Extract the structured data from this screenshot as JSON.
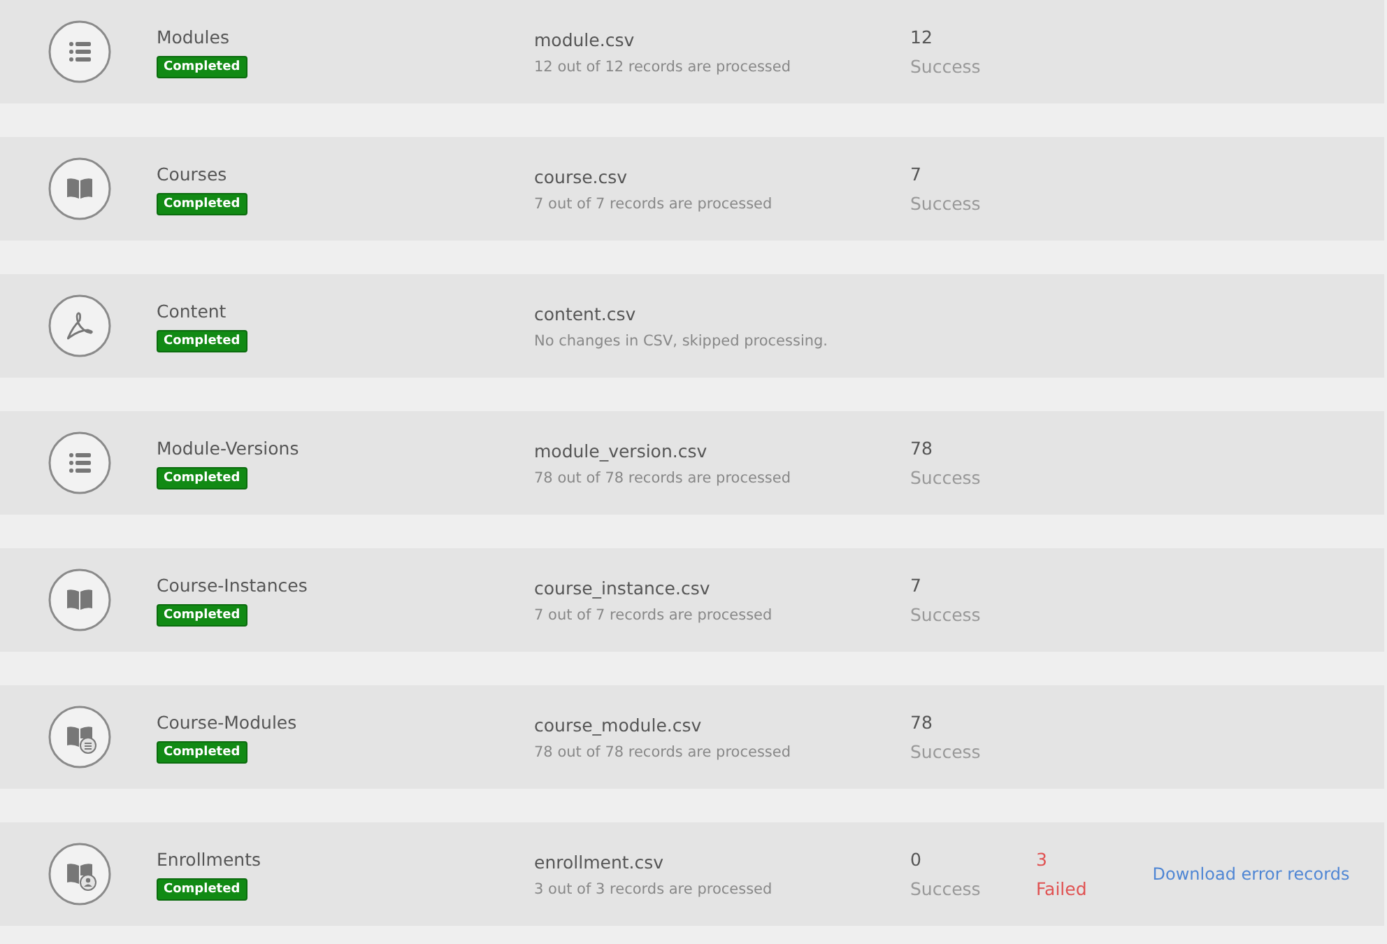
{
  "imports": [
    {
      "kind": "list",
      "name": "Modules",
      "status": "Completed",
      "file": "module.csv",
      "note": "12 out of 12 records are processed",
      "success": {
        "count": "12",
        "label": "Success"
      }
    },
    {
      "kind": "book",
      "name": "Courses",
      "status": "Completed",
      "file": "course.csv",
      "note": "7 out of 7 records are processed",
      "success": {
        "count": "7",
        "label": "Success"
      }
    },
    {
      "kind": "pdf",
      "name": "Content",
      "status": "Completed",
      "file": "content.csv",
      "note": "No changes in CSV, skipped processing."
    },
    {
      "kind": "list",
      "name": "Module-Versions",
      "status": "Completed",
      "file": "module_version.csv",
      "note": "78 out of 78 records are processed",
      "success": {
        "count": "78",
        "label": "Success"
      }
    },
    {
      "kind": "book",
      "name": "Course-Instances",
      "status": "Completed",
      "file": "course_instance.csv",
      "note": "7 out of 7 records are processed",
      "success": {
        "count": "7",
        "label": "Success"
      }
    },
    {
      "kind": "booklist",
      "name": "Course-Modules",
      "status": "Completed",
      "file": "course_module.csv",
      "note": "78 out of 78 records are processed",
      "success": {
        "count": "78",
        "label": "Success"
      }
    },
    {
      "kind": "bookuser",
      "name": "Enrollments",
      "status": "Completed",
      "file": "enrollment.csv",
      "note": "3 out of 3 records are processed",
      "success": {
        "count": "0",
        "label": "Success"
      },
      "failed": {
        "count": "3",
        "label": "Failed"
      },
      "link": "Download error records"
    }
  ]
}
